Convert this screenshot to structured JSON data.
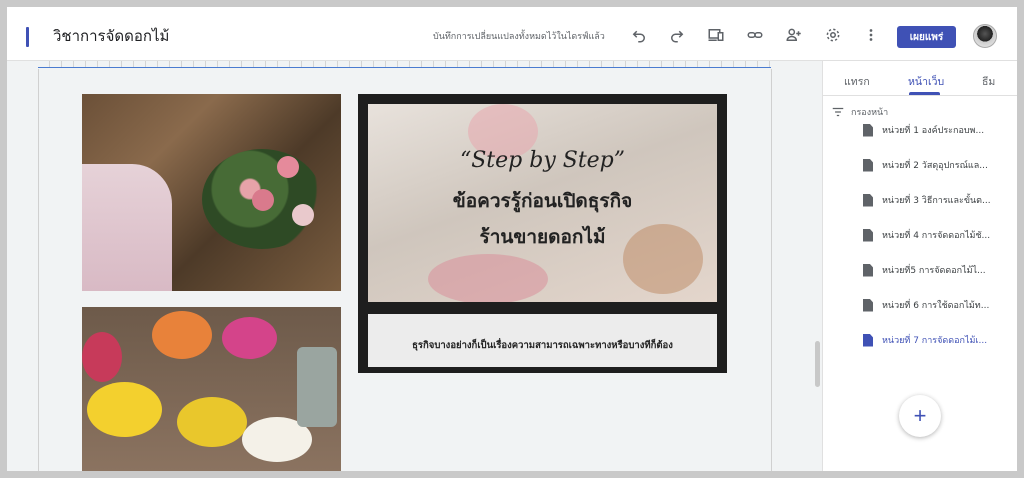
{
  "header": {
    "site_title": "วิชาการจัดดอกไม้",
    "save_status": "บันทึกการเปลี่ยนแปลงทั้งหมดไว้ในไดรฟ์แล้ว",
    "publish_label": "เผยแพร่",
    "icons": [
      "undo-icon",
      "redo-icon",
      "preview-devices-icon",
      "link-icon",
      "share-person-add-icon",
      "settings-gear-icon",
      "more-vert-icon"
    ]
  },
  "canvas": {
    "card": {
      "title_line1": "“Step by Step”",
      "title_line2": "ข้อควรรู้ก่อนเปิดธุรกิจ",
      "title_line3": "ร้านขายดอกไม้",
      "body_text": "ธุรกิจบางอย่างก็เป็นเรื่องความสามารถเฉพาะทางหรือบางทีก็ต้อง"
    }
  },
  "sidebar": {
    "tabs": [
      {
        "label": "แทรก"
      },
      {
        "label": "หน้าเว็บ"
      },
      {
        "label": "ธีม"
      }
    ],
    "filter_label": "กรองหน้า",
    "pages": [
      {
        "label": "หน่วยที่ 1 องค์ประกอบพ..."
      },
      {
        "label": "หน่วยที่ 2 วัสดุอุปกรณ์แล..."
      },
      {
        "label": "หน่วยที่ 3 วิธีการและขั้นต..."
      },
      {
        "label": "หน่วยที่ 4 การจัดดอกไม้ชั..."
      },
      {
        "label": "หน่วยที่5 การจัดดอกไม้ไ..."
      },
      {
        "label": "หน่วยที่ 6 การใช้ดอกไม้ท..."
      },
      {
        "label": "หน่วยที่ 7 การจัดดอกไม้เ..."
      }
    ],
    "add_label": "+"
  },
  "colors": {
    "accent": "#3f51b5"
  }
}
